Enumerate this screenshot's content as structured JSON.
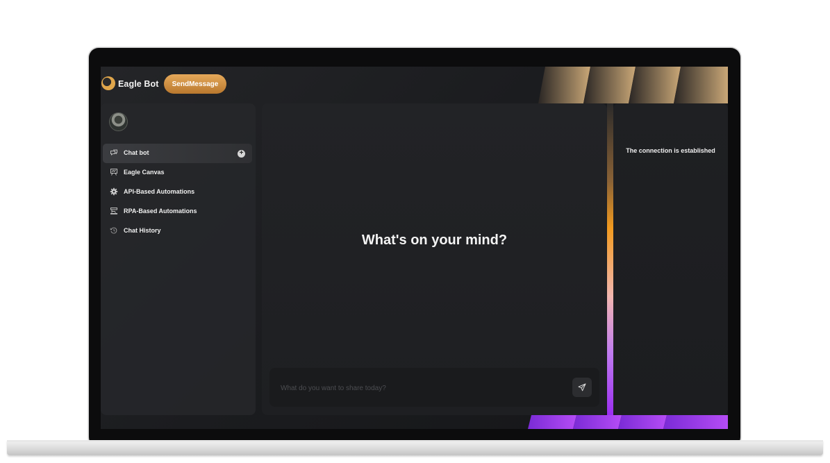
{
  "header": {
    "brand": "Eagle Bot",
    "send_button": "SendMessage"
  },
  "sidebar": {
    "items": [
      {
        "label": "Chat bot",
        "icon": "chat-bubbles-icon",
        "active": true
      },
      {
        "label": "Eagle Canvas",
        "icon": "presentation-board-icon",
        "active": false
      },
      {
        "label": "API-Based Automations",
        "icon": "gear-icon",
        "active": false
      },
      {
        "label": "RPA-Based Automations",
        "icon": "robot-arm-icon",
        "active": false
      },
      {
        "label": "Chat History",
        "icon": "history-clock-icon",
        "active": false
      }
    ]
  },
  "main": {
    "heading": "What's on your mind?",
    "input_placeholder": "What do you want to share today?"
  },
  "right_panel": {
    "status": "The connection is established"
  },
  "colors": {
    "accent_gold": "#d7994a",
    "accent_purple": "#a43cf0",
    "accent_orange": "#f0921c",
    "panel": "#232427"
  }
}
